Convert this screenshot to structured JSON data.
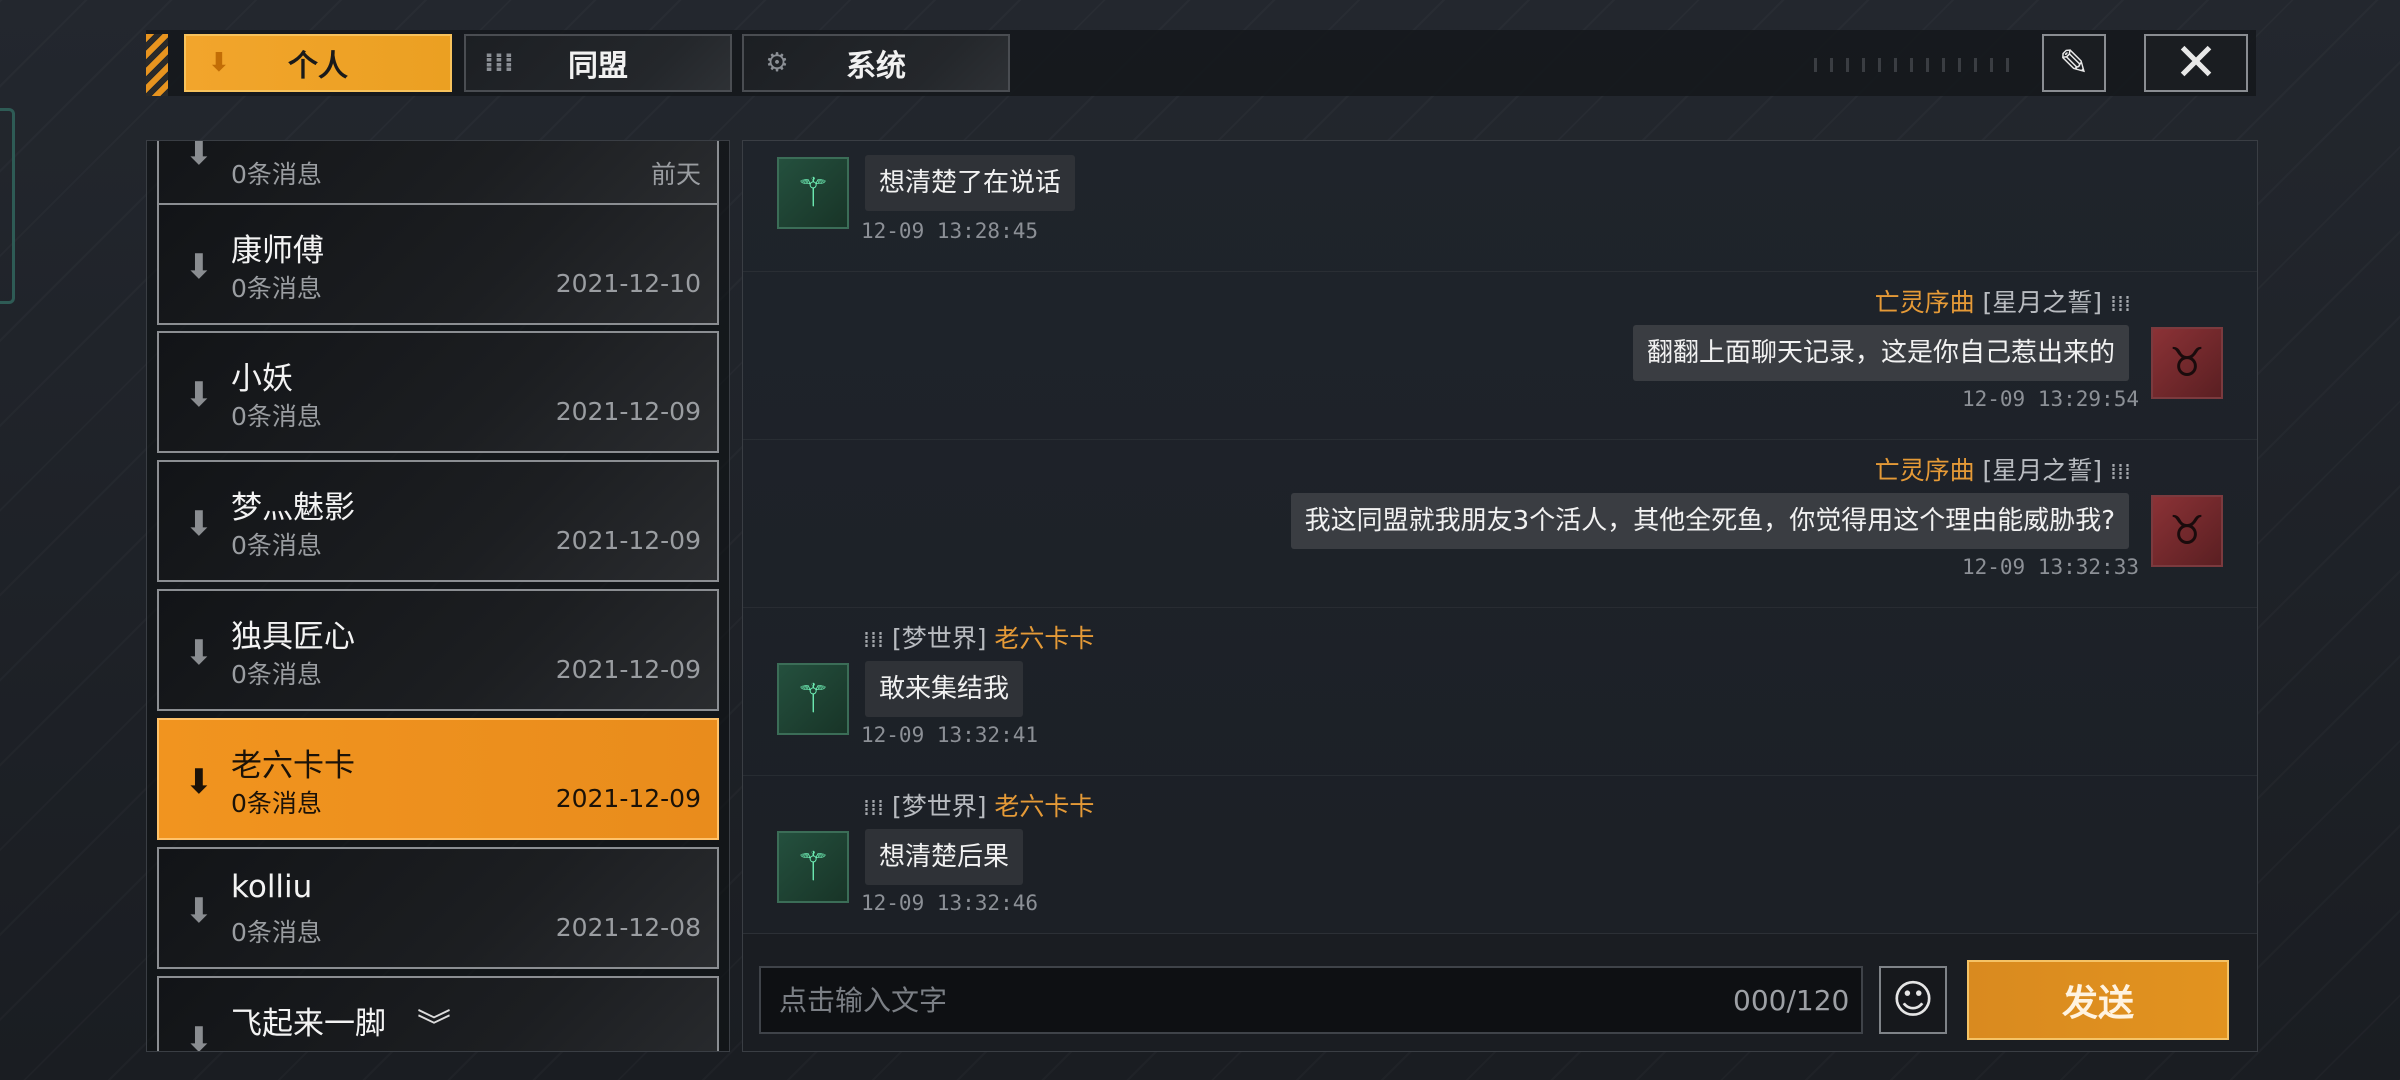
{
  "tabs": [
    {
      "label": "个人",
      "icon": "download-arrow-icon"
    },
    {
      "label": "同盟",
      "icon": "alliance-icon"
    },
    {
      "label": "系统",
      "icon": "gear-icon"
    }
  ],
  "contacts": [
    {
      "name": "",
      "msg": "0条消息",
      "date": "前天"
    },
    {
      "name": "康师傅",
      "msg": "0条消息",
      "date": "2021-12-10"
    },
    {
      "name": "小妖",
      "msg": "0条消息",
      "date": "2021-12-09"
    },
    {
      "name": "梦灬魅影",
      "msg": "0条消息",
      "date": "2021-12-09"
    },
    {
      "name": "独具匠心",
      "msg": "0条消息",
      "date": "2021-12-09"
    },
    {
      "name": "老六卡卡",
      "msg": "0条消息",
      "date": "2021-12-09"
    },
    {
      "name": "kolliu",
      "msg": "0条消息",
      "date": "2021-12-08"
    },
    {
      "name": "飞起来一脚",
      "msg": "",
      "date": ""
    }
  ],
  "messages": [
    {
      "side": "left",
      "alliance": "",
      "sender": "",
      "text": "想清楚了在说话",
      "time": "12-09 13:28:45"
    },
    {
      "side": "right",
      "alliance": "[星月之誓]",
      "sender": "亡灵序曲",
      "text": "翻翻上面聊天记录，这是你自己惹出来的",
      "time": "12-09 13:29:54"
    },
    {
      "side": "right",
      "alliance": "[星月之誓]",
      "sender": "亡灵序曲",
      "text": "我这同盟就我朋友3个活人，其他全死鱼，你觉得用这个理由能威胁我?",
      "time": "12-09 13:32:33"
    },
    {
      "side": "left",
      "alliance": "[梦世界]",
      "sender": "老六卡卡",
      "text": "敢来集结我",
      "time": "12-09 13:32:41"
    },
    {
      "side": "left",
      "alliance": "[梦世界]",
      "sender": "老六卡卡",
      "text": "想清楚后果",
      "time": "12-09 13:32:46"
    }
  ],
  "input": {
    "placeholder": "点击输入文字",
    "counter": "000/120"
  },
  "send_label": "发送",
  "colors": {
    "accent": "#f1941f",
    "sender_name": "#e59a37",
    "avatar_green": "#6ff0b6",
    "avatar_red": "#8b3236"
  }
}
